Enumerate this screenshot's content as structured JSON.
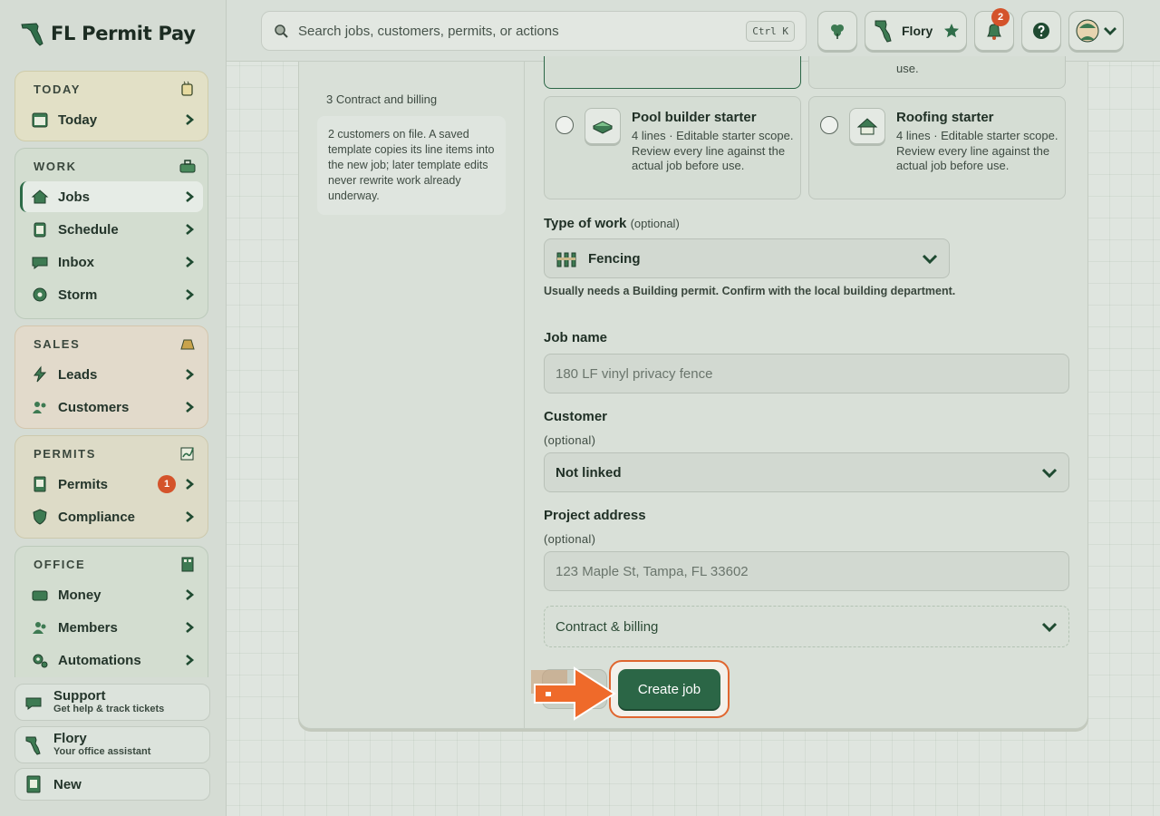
{
  "brand": {
    "name": "FL Permit Pay"
  },
  "sidebar": {
    "sections": [
      {
        "title": "TODAY",
        "items": [
          {
            "label": "Today"
          }
        ]
      },
      {
        "title": "WORK",
        "items": [
          {
            "label": "Jobs",
            "active": true
          },
          {
            "label": "Schedule"
          },
          {
            "label": "Inbox"
          },
          {
            "label": "Storm"
          }
        ]
      },
      {
        "title": "SALES",
        "items": [
          {
            "label": "Leads"
          },
          {
            "label": "Customers"
          }
        ]
      },
      {
        "title": "PERMITS",
        "items": [
          {
            "label": "Permits",
            "badge": "1"
          },
          {
            "label": "Compliance"
          }
        ]
      },
      {
        "title": "OFFICE",
        "items": [
          {
            "label": "Money"
          },
          {
            "label": "Members"
          },
          {
            "label": "Automations"
          }
        ]
      }
    ],
    "footer": {
      "support_title": "Support",
      "support_sub": "Get help & track tickets",
      "flory_title": "Flory",
      "flory_sub": "Your office assistant",
      "new_label": "New"
    }
  },
  "topbar": {
    "search_placeholder": "Search jobs, customers, permits, or actions",
    "search_shortcut": "Ctrl K",
    "assistant_name": "Flory",
    "notification_count": "2"
  },
  "form": {
    "steps": {
      "step3": "3 Contract and billing"
    },
    "info_text": "2 customers on file. A saved template copies its line items into the new job; later template edits never rewrite work already underway.",
    "partial_desc_right": "use.",
    "templates": [
      {
        "title": "Pool builder starter",
        "desc": "4 lines · Editable starter scope. Review every line against the actual job before use."
      },
      {
        "title": "Roofing starter",
        "desc": "4 lines · Editable starter scope. Review every line against the actual job before use."
      }
    ],
    "type_of_work": {
      "label": "Type of work",
      "optional": "(optional)",
      "value": "Fencing",
      "hint": "Usually needs a Building permit. Confirm with the local building department."
    },
    "job_name": {
      "label": "Job name",
      "placeholder": "180 LF vinyl privacy fence"
    },
    "customer": {
      "label": "Customer",
      "optional": "(optional)",
      "value": "Not linked"
    },
    "project_address": {
      "label": "Project address",
      "optional": "(optional)",
      "placeholder": "123 Maple St, Tampa, FL 33602"
    },
    "contract_billing": {
      "label": "Contract & billing"
    },
    "create_button": "Create job"
  },
  "colors": {
    "accent": "#2b6646",
    "badge": "#d4532b",
    "highlight": "#e0662f"
  }
}
